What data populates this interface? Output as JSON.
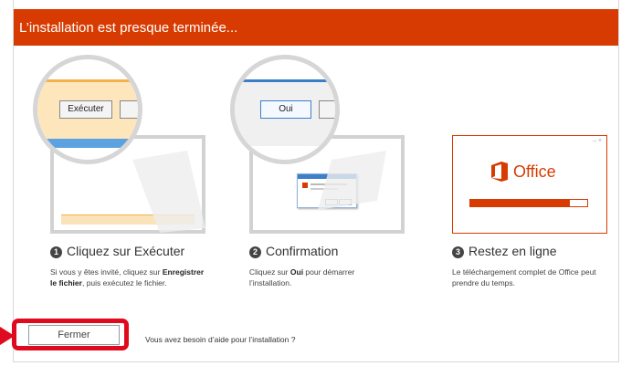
{
  "window": {
    "title": "L’installation est presque terminée..."
  },
  "steps": [
    {
      "number": "1",
      "title": "Cliquez sur Exécuter",
      "desc_part1": "Si vous y êtes invité, cliquez sur ",
      "desc_bold": "Enregistrer le fichier",
      "desc_part2": ", puis exécutez le fichier.",
      "zoom_button_label": "Exécuter"
    },
    {
      "number": "2",
      "title": "Confirmation",
      "desc_part1": "Cliquez sur ",
      "desc_bold": "Oui",
      "desc_part2": " pour démarrer l’installation.",
      "zoom_button_label": "Oui"
    },
    {
      "number": "3",
      "title": "Restez en ligne",
      "desc_part1": "Le téléchargement complet de Office peut prendre du temps.",
      "splash_label": "Office",
      "splash_progress": 0.85
    }
  ],
  "footer": {
    "close_label": "Fermer",
    "help_text": "Vous avez besoin d’aide pour l’installation ?"
  },
  "colors": {
    "accent": "#d83b01",
    "highlight": "#e00a1e",
    "pointer": "#e00a1e"
  }
}
